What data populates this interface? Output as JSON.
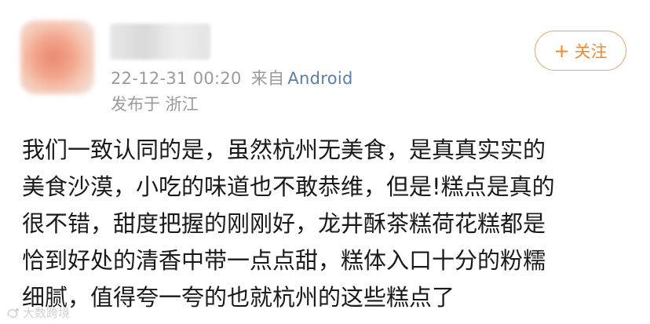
{
  "post": {
    "timestamp": "22-12-31 00:20",
    "source_prefix": "来自",
    "source": "Android",
    "location": "发布于 浙江",
    "follow": {
      "plus": "+",
      "label": "关注"
    },
    "content_lines": [
      "我们一致认同的是，虽然杭州无美食，是真真实实的",
      "美食沙漠，小吃的味道也不敢恭维，但是!糕点是真的",
      "很不错，甜度把握的刚刚好，龙井酥茶糕荷花糕都是",
      "恰到好处的清香中带一点点甜，糕体入口十分的粉糯",
      "细腻，值得夸一夸的也就杭州的这些糕点了"
    ]
  },
  "watermark": {
    "text": "大数跨境"
  },
  "colors": {
    "accent": "#f08a2f",
    "source_link": "#5b7ea8",
    "meta_text": "#9a9a9a",
    "body_text": "#1a1a1a"
  },
  "icons": {
    "avatar": "blurred-avatar",
    "watermark": "logo-icon"
  }
}
